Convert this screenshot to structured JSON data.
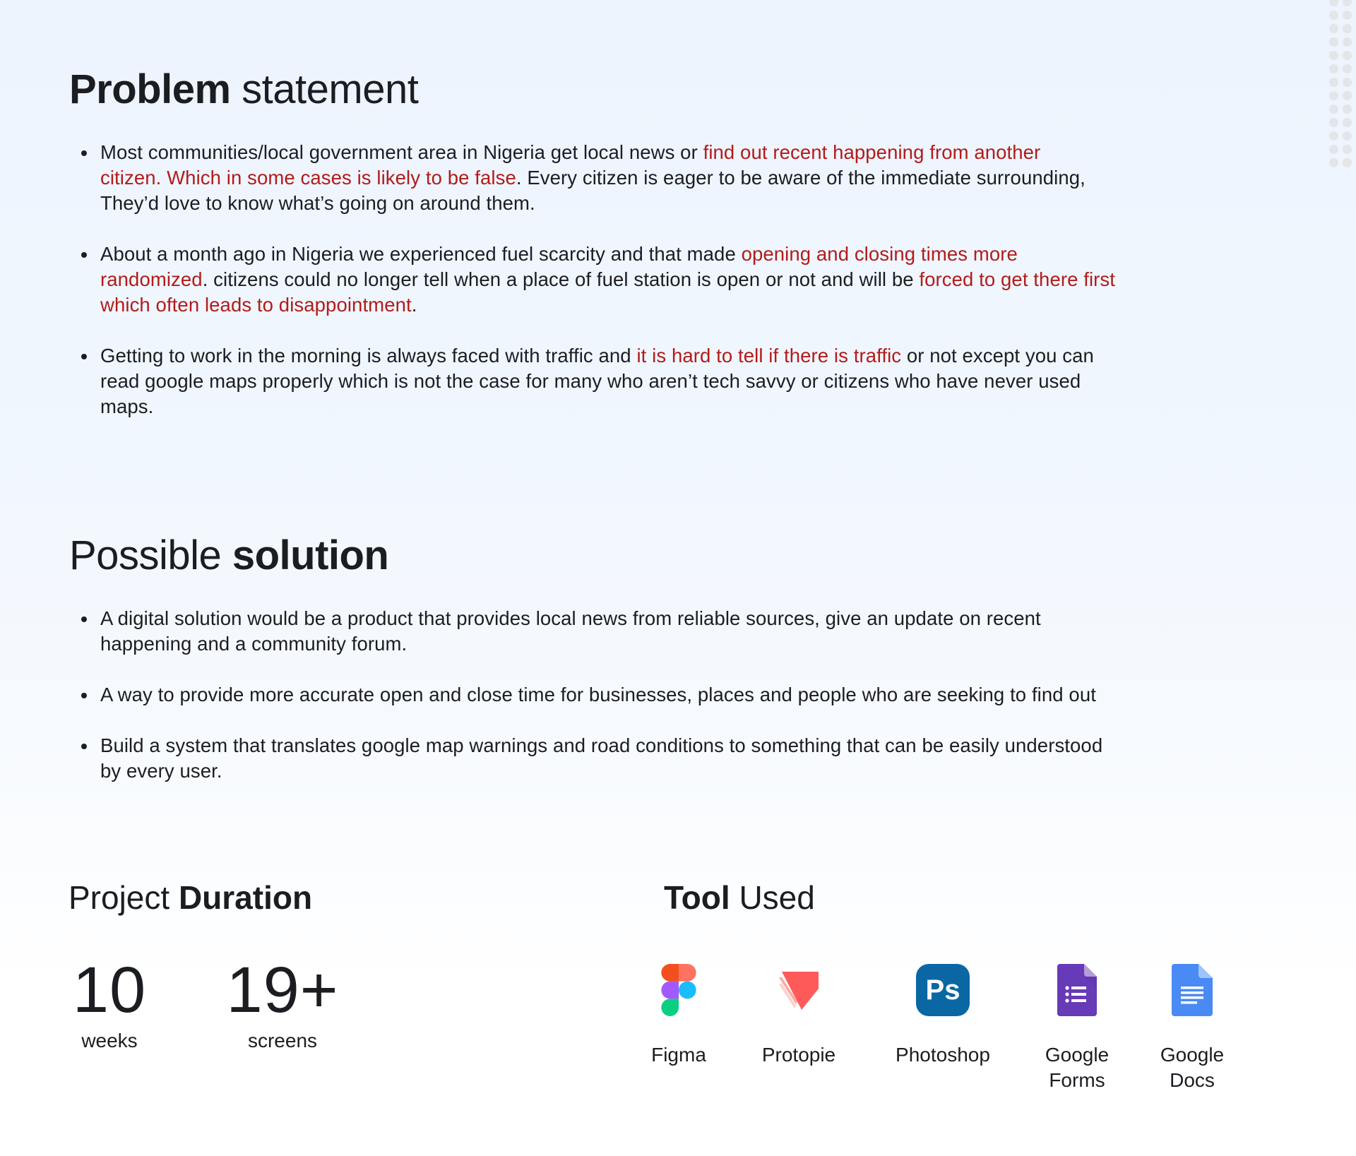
{
  "problem": {
    "title_bold": "Problem",
    "title_regular": " statement",
    "items": [
      {
        "lines": [
          [
            {
              "t": "Most communities/local government area in Nigeria get local news or ",
              "hl": false
            },
            {
              "t": "find out recent happening from another",
              "hl": true
            }
          ],
          [
            {
              "t": "citizen. Which in some cases is likely to be false",
              "hl": true
            },
            {
              "t": ". Every citizen is eager to be aware of the immediate surrounding,",
              "hl": false
            }
          ],
          [
            {
              "t": "They’d love to know what’s going on around them.",
              "hl": false
            }
          ]
        ]
      },
      {
        "lines": [
          [
            {
              "t": "About a month ago in Nigeria we experienced fuel scarcity and that made ",
              "hl": false
            },
            {
              "t": "opening and closing times more",
              "hl": true
            }
          ],
          [
            {
              "t": "randomized",
              "hl": true
            },
            {
              "t": ". citizens could no longer tell when a place of fuel station is open or not and will be ",
              "hl": false
            },
            {
              "t": "forced to get there first",
              "hl": true
            }
          ],
          [
            {
              "t": "which often leads to disappointment",
              "hl": true
            },
            {
              "t": ".",
              "hl": false
            }
          ]
        ]
      },
      {
        "lines": [
          [
            {
              "t": "Getting to work in the morning is always faced with traffic and ",
              "hl": false
            },
            {
              "t": "it is hard to tell if there is traffic",
              "hl": true
            },
            {
              "t": " or not except you can",
              "hl": false
            }
          ],
          [
            {
              "t": "read google maps properly which is not the case for many who aren’t tech savvy or citizens who have never used",
              "hl": false
            }
          ],
          [
            {
              "t": "maps.",
              "hl": false
            }
          ]
        ]
      }
    ]
  },
  "solution": {
    "title_regular": "Possible ",
    "title_bold": "solution",
    "items": [
      {
        "lines": [
          "A digital solution would be a product that provides local news from reliable sources, give an update on recent",
          "happening and a community forum."
        ]
      },
      {
        "lines": [
          "A way to provide more accurate open and close time for businesses, places and people who are seeking to find out"
        ]
      },
      {
        "lines": [
          "Build a system that translates google map warnings and road conditions to something that can be easily understood",
          "by every user."
        ]
      }
    ]
  },
  "duration": {
    "title_regular": "Project ",
    "title_bold": "Duration",
    "stats": [
      {
        "value": "10",
        "unit": "weeks"
      },
      {
        "value": "19+",
        "unit": "screens"
      }
    ]
  },
  "tools": {
    "title_bold": "Tool",
    "title_regular": " Used",
    "items": [
      {
        "name": "Figma",
        "icon": "figma-icon"
      },
      {
        "name": "Protopie",
        "icon": "protopie-icon"
      },
      {
        "name": "Photoshop",
        "icon": "photoshop-icon"
      },
      {
        "name": "Google Forms",
        "icon": "google-forms-icon"
      },
      {
        "name": "Google Docs",
        "icon": "google-docs-icon"
      }
    ]
  },
  "colors": {
    "highlight": "#B31B1B",
    "text": "#1B1D21",
    "photoshop_bg": "#0A67A4",
    "forms_bg": "#673AB7",
    "docs_bg": "#4A8AF4"
  }
}
